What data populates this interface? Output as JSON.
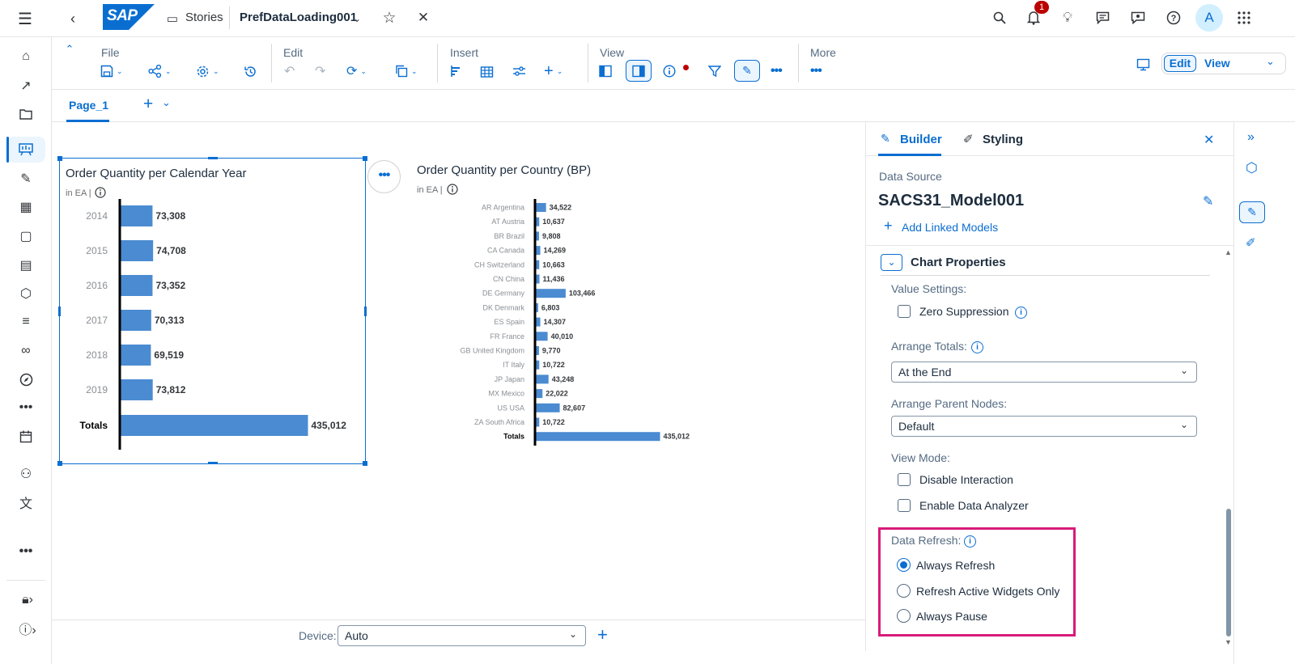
{
  "shell": {
    "app_title": "Stories",
    "doc_title": "PrefDataLoading001",
    "notification_count": "1",
    "avatar_initial": "A"
  },
  "toolbar": {
    "file_label": "File",
    "edit_label": "Edit",
    "insert_label": "Insert",
    "view_label": "View",
    "more_label": "More",
    "mode_edit": "Edit",
    "mode_view": "View"
  },
  "pages": {
    "tab1": "Page_1"
  },
  "chart1": {
    "title": "Order Quantity per Calendar Year",
    "subtitle": "in EA |"
  },
  "chart2": {
    "title": "Order Quantity per Country (BP)",
    "subtitle": "in EA |"
  },
  "chart_data": [
    {
      "type": "bar",
      "orientation": "horizontal",
      "title": "Order Quantity per Calendar Year",
      "subtitle": "in EA",
      "categories": [
        "2014",
        "2015",
        "2016",
        "2017",
        "2018",
        "2019",
        "Totals"
      ],
      "values": [
        73308,
        74708,
        73352,
        70313,
        69519,
        73812,
        435012
      ],
      "labels": [
        "73,308",
        "74,708",
        "73,352",
        "70,313",
        "69,519",
        "73,812",
        "435,012"
      ],
      "color": "#4a8bd1"
    },
    {
      "type": "bar",
      "orientation": "horizontal",
      "title": "Order Quantity per Country (BP)",
      "subtitle": "in EA",
      "categories": [
        "AR Argentina",
        "AT Austria",
        "BR Brazil",
        "CA Canada",
        "CH Switzerland",
        "CN China",
        "DE Germany",
        "DK Denmark",
        "ES Spain",
        "FR France",
        "GB United Kingdom",
        "IT Italy",
        "JP Japan",
        "MX Mexico",
        "US USA",
        "ZA South Africa",
        "Totals"
      ],
      "values": [
        34522,
        10637,
        9808,
        14269,
        10663,
        11436,
        103466,
        6803,
        14307,
        40010,
        9770,
        10722,
        43248,
        22022,
        82607,
        10722,
        435012
      ],
      "labels": [
        "34,522",
        "10,637",
        "9,808",
        "14,269",
        "10,663",
        "11,436",
        "103,466",
        "6,803",
        "14,307",
        "40,010",
        "9,770",
        "10,722",
        "43,248",
        "22,022",
        "82,607",
        "10,722",
        "435,012"
      ],
      "color": "#4a8bd1"
    }
  ],
  "bottom": {
    "device_label": "Device:",
    "device_value": "Auto"
  },
  "builder": {
    "tab_builder": "Builder",
    "tab_styling": "Styling",
    "data_source_label": "Data Source",
    "model_name": "SACS31_Model001",
    "add_linked": "Add Linked Models",
    "section_title": "Chart Properties",
    "value_settings": "Value Settings:",
    "zero_suppression": "Zero Suppression",
    "arrange_totals": "Arrange Totals:",
    "arrange_totals_value": "At the End",
    "arrange_parent": "Arrange Parent Nodes:",
    "arrange_parent_value": "Default",
    "view_mode": "View Mode:",
    "disable_interaction": "Disable Interaction",
    "enable_data_analyzer": "Enable Data Analyzer",
    "data_refresh": "Data Refresh:",
    "always_refresh": "Always Refresh",
    "refresh_active": "Refresh Active Widgets Only",
    "always_pause": "Always Pause",
    "selected_refresh": "Always Refresh"
  },
  "colors": {
    "accent": "#0a6ed1",
    "highlight_box": "#d81b7a",
    "bar": "#4a8bd1"
  }
}
